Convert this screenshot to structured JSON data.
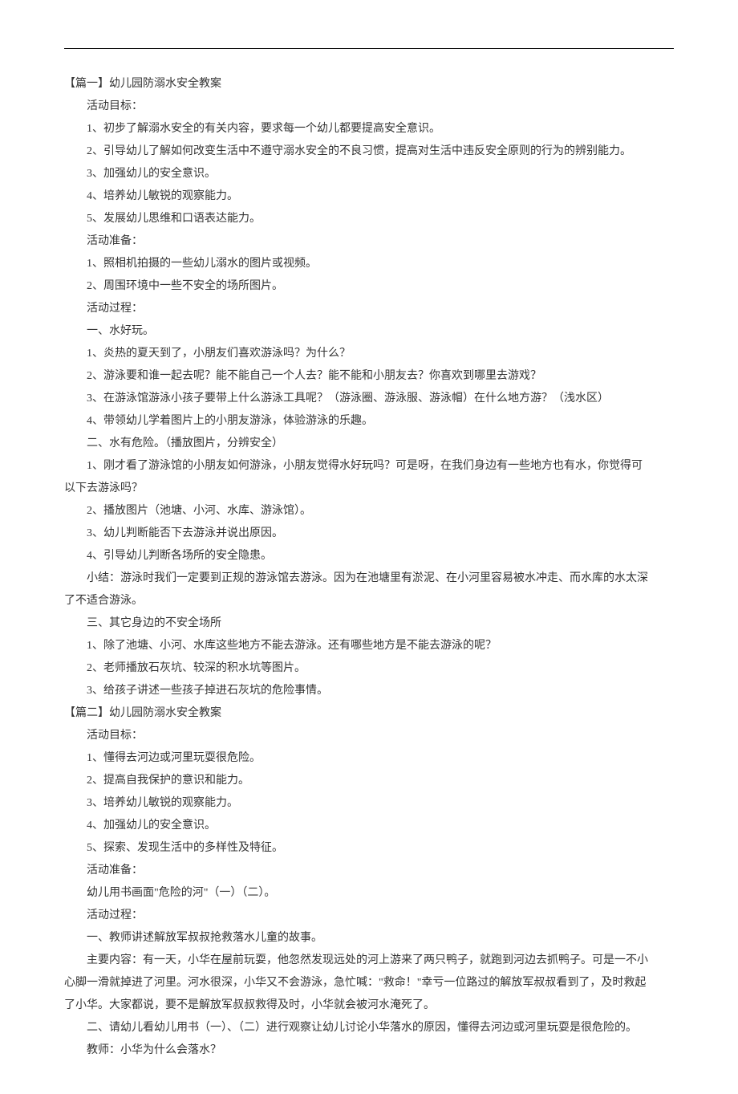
{
  "lines": [
    {
      "cls": "l0",
      "text": "【篇一】幼儿园防溺水安全教案"
    },
    {
      "cls": "l1",
      "text": "活动目标："
    },
    {
      "cls": "l1",
      "text": "1、初步了解溺水安全的有关内容，要求每一个幼儿都要提高安全意识。"
    },
    {
      "cls": "l1",
      "text": "2、引导幼儿了解如何改变生活中不遵守溺水安全的不良习惯，提高对生活中违反安全原则的行为的辨别能力。"
    },
    {
      "cls": "l1",
      "text": "3、加强幼儿的安全意识。"
    },
    {
      "cls": "l1",
      "text": "4、培养幼儿敏锐的观察能力。"
    },
    {
      "cls": "l1",
      "text": "5、发展幼儿思维和口语表达能力。"
    },
    {
      "cls": "l1",
      "text": "活动准备："
    },
    {
      "cls": "l1",
      "text": "1、照相机拍摄的一些幼儿溺水的图片或视频。"
    },
    {
      "cls": "l1",
      "text": "2、周围环境中一些不安全的场所图片。"
    },
    {
      "cls": "l1",
      "text": "活动过程："
    },
    {
      "cls": "l1",
      "text": "一、水好玩。"
    },
    {
      "cls": "l1",
      "text": "1、炎热的夏天到了，小朋友们喜欢游泳吗？为什么？"
    },
    {
      "cls": "l1",
      "text": "2、游泳要和谁一起去呢？能不能自己一个人去？能不能和小朋友去？你喜欢到哪里去游戏？"
    },
    {
      "cls": "l1",
      "text": "3、在游泳馆游泳小孩子要带上什么游泳工具呢？（游泳圈、游泳服、游泳帽）在什么地方游？（浅水区）"
    },
    {
      "cls": "l1",
      "text": "4、带领幼儿学着图片上的小朋友游泳，体验游泳的乐趣。"
    },
    {
      "cls": "l1",
      "text": "二、水有危险。（播放图片，分辨安全）"
    },
    {
      "cls": "l1",
      "text": "1、刚才看了游泳馆的小朋友如何游泳，小朋友觉得水好玩吗？可是呀，在我们身边有一些地方也有水，你觉得可"
    },
    {
      "cls": "l0",
      "text": "以下去游泳吗？"
    },
    {
      "cls": "l1",
      "text": "2、播放图片（池塘、小河、水库、游泳馆）。"
    },
    {
      "cls": "l1",
      "text": "3、幼儿判断能否下去游泳并说出原因。"
    },
    {
      "cls": "l1",
      "text": "4、引导幼儿判断各场所的安全隐患。"
    },
    {
      "cls": "l1",
      "text": "小结：游泳时我们一定要到正规的游泳馆去游泳。因为在池塘里有淤泥、在小河里容易被水冲走、而水库的水太深"
    },
    {
      "cls": "l0",
      "text": "了不适合游泳。"
    },
    {
      "cls": "l1",
      "text": "三、其它身边的不安全场所"
    },
    {
      "cls": "l1",
      "text": "1、除了池塘、小河、水库这些地方不能去游泳。还有哪些地方是不能去游泳的呢？"
    },
    {
      "cls": "l1",
      "text": "2、老师播放石灰坑、较深的积水坑等图片。"
    },
    {
      "cls": "l1",
      "text": "3、给孩子讲述一些孩子掉进石灰坑的危险事情。"
    },
    {
      "cls": "l0",
      "text": "【篇二】幼儿园防溺水安全教案"
    },
    {
      "cls": "l1",
      "text": "活动目标："
    },
    {
      "cls": "l1",
      "text": "1、懂得去河边或河里玩耍很危险。"
    },
    {
      "cls": "l1",
      "text": "2、提高自我保护的意识和能力。"
    },
    {
      "cls": "l1",
      "text": "3、培养幼儿敏锐的观察能力。"
    },
    {
      "cls": "l1",
      "text": "4、加强幼儿的安全意识。"
    },
    {
      "cls": "l1",
      "text": "5、探索、发现生活中的多样性及特征。"
    },
    {
      "cls": "l1",
      "text": "活动准备："
    },
    {
      "cls": "l1",
      "text": "幼儿用书画面\"危险的河\"（一）（二）。"
    },
    {
      "cls": "l1",
      "text": "活动过程："
    },
    {
      "cls": "l1",
      "text": "一、教师讲述解放军叔叔抢救落水儿童的故事。"
    },
    {
      "cls": "l1",
      "text": "主要内容：有一天，小华在屋前玩耍，他忽然发现远处的河上游来了两只鸭子，就跑到河边去抓鸭子。可是一不小"
    },
    {
      "cls": "l0",
      "text": "心脚一滑就掉进了河里。河水很深，小华又不会游泳，急忙喊：\"救命！\"幸亏一位路过的解放军叔叔看到了，及时救起"
    },
    {
      "cls": "l0",
      "text": "了小华。大家都说，要不是解放军叔叔救得及时，小华就会被河水淹死了。"
    },
    {
      "cls": "l1",
      "text": "二、请幼儿看幼儿用书（一）、（二）进行观察让幼儿讨论小华落水的原因，懂得去河边或河里玩耍是很危险的。"
    },
    {
      "cls": "l1",
      "text": "教师：小华为什么会落水？"
    }
  ]
}
